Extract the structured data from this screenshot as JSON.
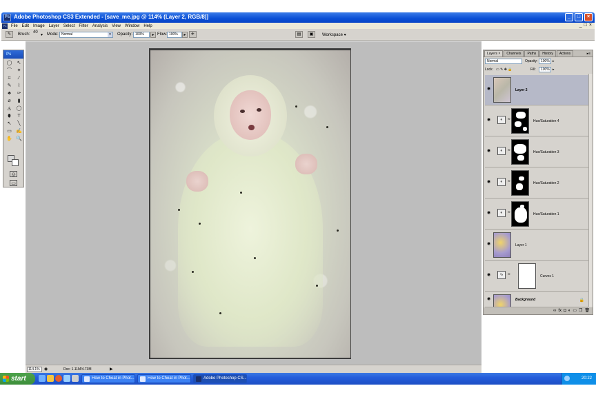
{
  "window": {
    "title": "Adobe Photoshop CS3 Extended - [save_me.jpg @ 114% (Layer 2, RGB/8)]",
    "app_icon": "Ps"
  },
  "menu": [
    "File",
    "Edit",
    "Image",
    "Layer",
    "Select",
    "Filter",
    "Analysis",
    "View",
    "Window",
    "Help"
  ],
  "options_bar": {
    "brush_label": "Brush:",
    "brush_size": "40",
    "mode_label": "Mode:",
    "mode_value": "Normal",
    "opacity_label": "Opacity:",
    "opacity_value": "100%",
    "flow_label": "Flow:",
    "flow_value": "100%",
    "workspace_label": "Workspace ▾"
  },
  "toolbox": {
    "header": "Ps",
    "tools": [
      "◯",
      "↖",
      "⌒",
      "✦",
      "⌗",
      "⁄",
      "✎",
      "⌇",
      "♣",
      "✑",
      "⌀",
      "▮",
      "◬",
      "◯",
      "⬮",
      "T",
      "↖",
      "╲",
      "▭",
      "✍",
      "✋",
      "🔍"
    ]
  },
  "status": {
    "zoom": "114.1%",
    "doc_info": "Doc: 1.11M/4.73M"
  },
  "layers_panel": {
    "tabs": [
      "Layers ×",
      "Channels",
      "Paths",
      "History",
      "Actions"
    ],
    "blend_mode": "Normal",
    "opacity_label": "Opacity:",
    "opacity_value": "100%",
    "lock_label": "Lock:",
    "fill_label": "Fill:",
    "fill_value": "100%",
    "layers": [
      {
        "name": "Layer 2",
        "type": "pixel",
        "selected": true
      },
      {
        "name": "Hue/Saturation 4",
        "type": "adjustment"
      },
      {
        "name": "Hue/Saturation 3",
        "type": "adjustment"
      },
      {
        "name": "Hue/Saturation 2",
        "type": "adjustment"
      },
      {
        "name": "Hue/Saturation 1",
        "type": "adjustment"
      },
      {
        "name": "Layer 1",
        "type": "pixel"
      },
      {
        "name": "Curves 1",
        "type": "adjustment"
      },
      {
        "name": "Background",
        "type": "pixel"
      }
    ]
  },
  "taskbar": {
    "start_label": "start",
    "items": [
      {
        "label": "How to Cheat in Phot...",
        "active": false
      },
      {
        "label": "How to Cheat in Phot...",
        "active": false
      },
      {
        "label": "Adobe Photoshop CS...",
        "active": true
      }
    ],
    "clock": "20:22"
  },
  "colors": {
    "title_blue": "#0a4fd6",
    "workspace_gray": "#bdbdbd",
    "panel_gray": "#d6d3ce",
    "selected_layer": "#b6b9c8",
    "taskbar_blue": "#245ddb",
    "start_green": "#3c8e3a"
  }
}
